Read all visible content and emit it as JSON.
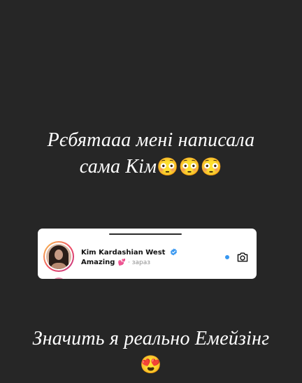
{
  "story": {
    "caption_top": {
      "text": "Рєбятааа мені написала сама Кім",
      "line1": "Рєбятааа мені написала",
      "line2": "сама Кім",
      "emojis": "😳😳😳"
    },
    "caption_bottom": {
      "text": "Значить я реально Емейзінг",
      "emoji": "😍"
    }
  },
  "dm_card": {
    "username": "Kim Kardashian West",
    "verified": true,
    "message": "Amazing",
    "message_emoji": "💕",
    "timestamp": "· зараз",
    "unread": true,
    "icons": [
      "verified-badge-icon",
      "unread-dot-icon",
      "camera-icon"
    ]
  },
  "colors": {
    "background": "#262626",
    "caption": "#ffffff",
    "card": "#ffffff",
    "unread_dot": "#3797f0",
    "verified": "#3897f0",
    "timestamp": "#8e8e8e"
  }
}
